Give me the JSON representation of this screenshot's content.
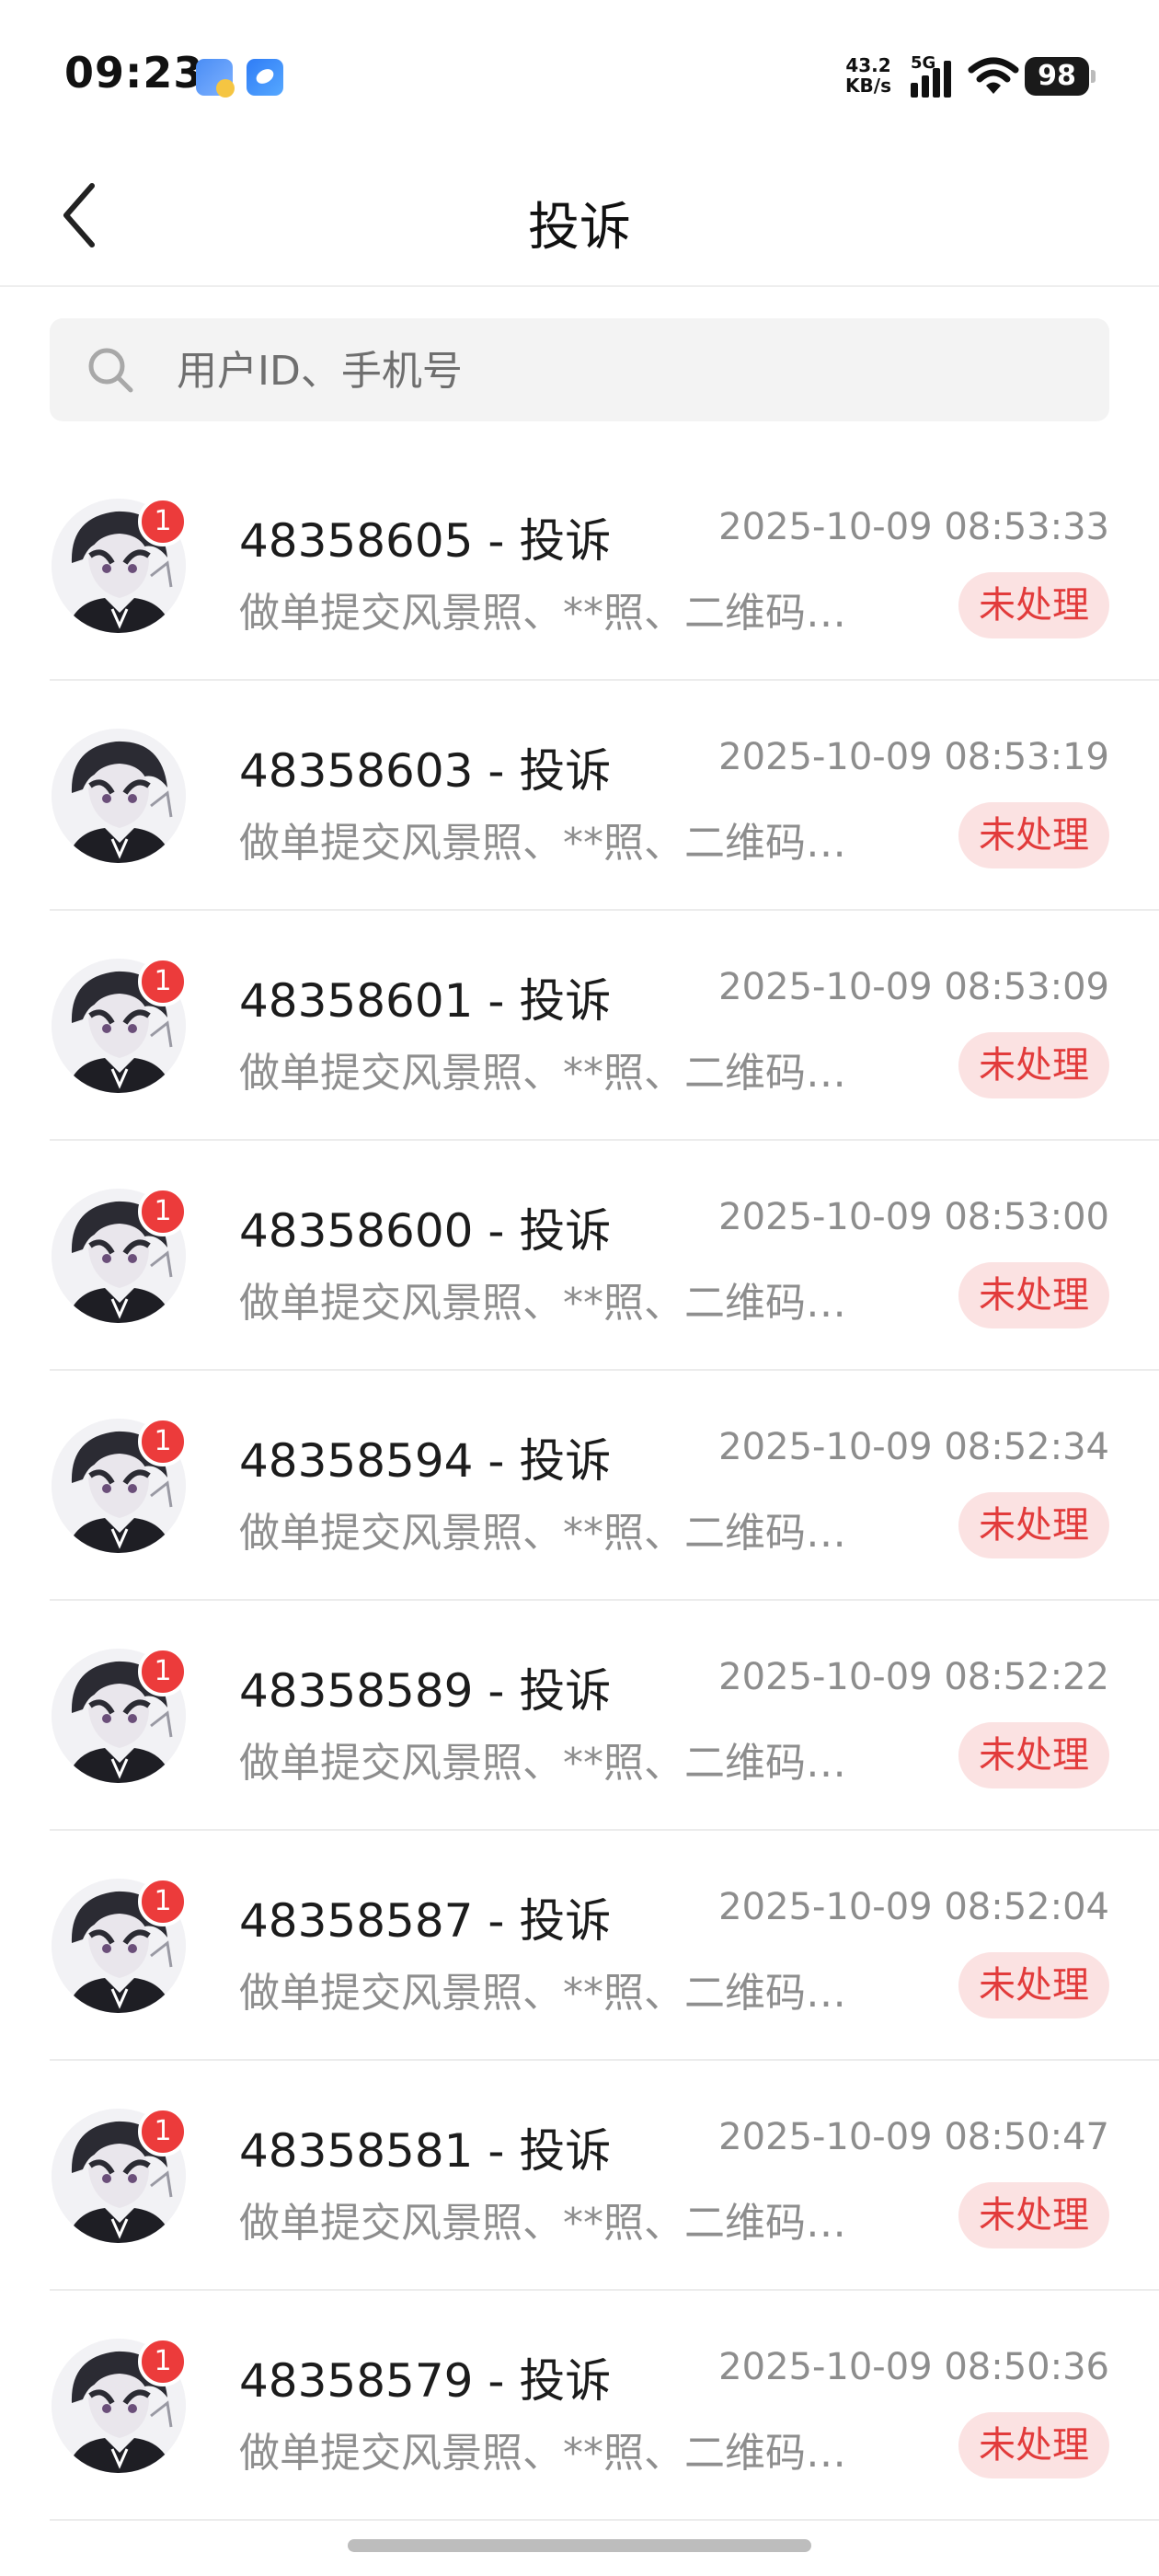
{
  "status_bar": {
    "time": "09:23",
    "net_speed_value": "43.2",
    "net_speed_unit": "KB/s",
    "network_type": "5G",
    "battery": "98"
  },
  "header": {
    "title": "投诉"
  },
  "search": {
    "placeholder": "用户ID、手机号",
    "value": ""
  },
  "complaints": [
    {
      "title": "48358605 - 投诉",
      "time": "2025-10-09 08:53:33",
      "desc": "做单提交风景照、**照、二维码…",
      "status": "未处理",
      "badge": "1"
    },
    {
      "title": "48358603 - 投诉",
      "time": "2025-10-09 08:53:19",
      "desc": "做单提交风景照、**照、二维码…",
      "status": "未处理",
      "badge": ""
    },
    {
      "title": "48358601 - 投诉",
      "time": "2025-10-09 08:53:09",
      "desc": "做单提交风景照、**照、二维码…",
      "status": "未处理",
      "badge": "1"
    },
    {
      "title": "48358600 - 投诉",
      "time": "2025-10-09 08:53:00",
      "desc": "做单提交风景照、**照、二维码…",
      "status": "未处理",
      "badge": "1"
    },
    {
      "title": "48358594 - 投诉",
      "time": "2025-10-09 08:52:34",
      "desc": "做单提交风景照、**照、二维码…",
      "status": "未处理",
      "badge": "1"
    },
    {
      "title": "48358589 - 投诉",
      "time": "2025-10-09 08:52:22",
      "desc": "做单提交风景照、**照、二维码…",
      "status": "未处理",
      "badge": "1"
    },
    {
      "title": "48358587 - 投诉",
      "time": "2025-10-09 08:52:04",
      "desc": "做单提交风景照、**照、二维码…",
      "status": "未处理",
      "badge": "1"
    },
    {
      "title": "48358581 - 投诉",
      "time": "2025-10-09 08:50:47",
      "desc": "做单提交风景照、**照、二维码…",
      "status": "未处理",
      "badge": "1"
    },
    {
      "title": "48358579 - 投诉",
      "time": "2025-10-09 08:50:36",
      "desc": "做单提交风景照、**照、二维码…",
      "status": "未处理",
      "badge": "1"
    }
  ],
  "colors": {
    "accent_red": "#ec3b3b",
    "status_tag_bg": "#fbe2e2",
    "status_tag_text": "#e23b3b"
  },
  "icons": {
    "back": "chevron-left-icon",
    "search": "search-icon",
    "wifi": "wifi-icon",
    "signal": "signal-icon",
    "battery": "battery-icon"
  }
}
